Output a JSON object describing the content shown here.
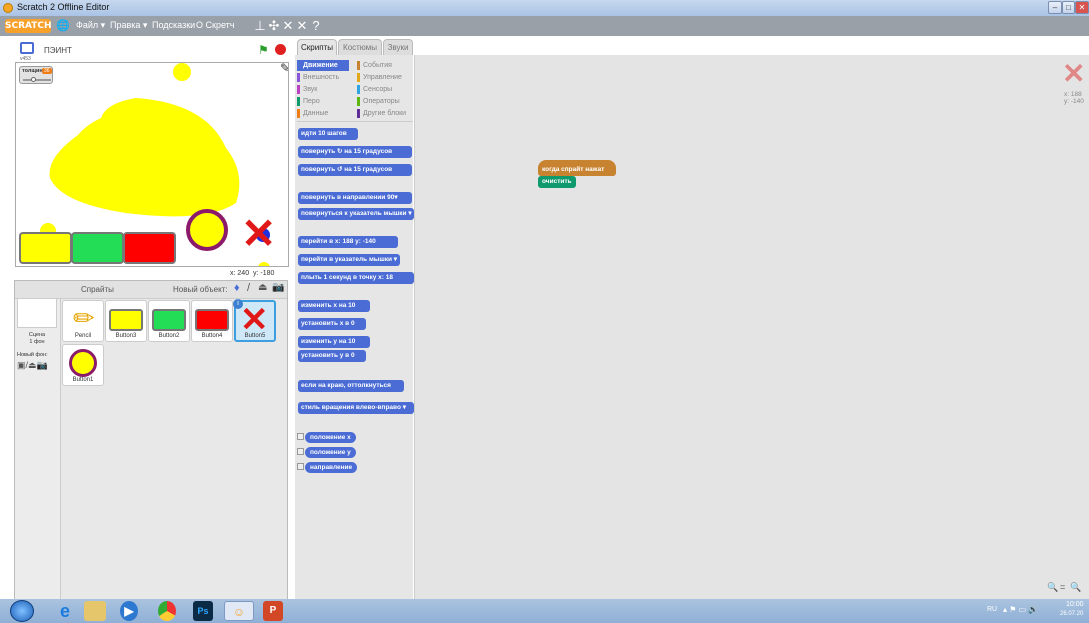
{
  "window": {
    "title": "Scratch 2 Offline Editor"
  },
  "menubar": {
    "logo": "SCRATCH",
    "file": "Файл ▾",
    "edit": "Правка ▾",
    "tips": "Подсказки",
    "about": "О Скретч",
    "tools": [
      "⊥",
      "✣",
      "✕",
      "✕",
      "?"
    ]
  },
  "stage": {
    "project_title": "ПЭИНТ",
    "version": "v453",
    "slider_label": "толщина",
    "slider_value": "36",
    "mouse_x": "240",
    "mouse_y": "-180",
    "x_label": "x:",
    "y_label": "y:"
  },
  "tabs": [
    "Скрипты",
    "Костюмы",
    "Звуки"
  ],
  "categories": [
    {
      "label": "Движение",
      "color": "#4a6cd4"
    },
    {
      "label": "События",
      "color": "#c88330"
    },
    {
      "label": "Внешность",
      "color": "#8a55d7"
    },
    {
      "label": "Управление",
      "color": "#e1a91a"
    },
    {
      "label": "Звук",
      "color": "#bb42c3"
    },
    {
      "label": "Сенсоры",
      "color": "#2ca5e2"
    },
    {
      "label": "Перо",
      "color": "#0e9a6c"
    },
    {
      "label": "Операторы",
      "color": "#5cb712"
    },
    {
      "label": "Данные",
      "color": "#ee7d16"
    },
    {
      "label": "Другие блоки",
      "color": "#632d99"
    }
  ],
  "blocks": [
    "идти 10 шагов",
    "повернуть ↻ на 15 градусов",
    "повернуть ↺ на 15 градусов",
    "повернуть в направлении 90▾",
    "повернуться к указатель мышки ▾",
    "перейти в x: 188 y: -140",
    "перейти в указатель мышки ▾",
    "плыть 1 секунд в точку x: 18",
    "изменить х на 10",
    "установить х в 0",
    "изменить у на 10",
    "установить у в 0",
    "если на краю, оттолкнуться",
    "стиль вращения влево-вправо ▾"
  ],
  "reporters": [
    "положение x",
    "положение y",
    "направление"
  ],
  "sprites": {
    "header": "Спрайты",
    "new_object_label": "Новый объект:",
    "stage_label": "Сцена",
    "stage_sub": "1 фон",
    "new_backdrop_label": "Новый фон:",
    "items": [
      "Pencil",
      "Button3",
      "Button2",
      "Button4",
      "Button5",
      "Button1"
    ],
    "selected": "Button5"
  },
  "scripts": {
    "hat": "когда спрайт нажат",
    "command": "очистить"
  },
  "sprite_info": {
    "x": "x: 188",
    "y": "y: -140"
  },
  "zoom": {
    "out": "🔍",
    "reset": "=",
    "in": "🔍"
  },
  "taskbar": {
    "lang": "RU",
    "time": "10:00",
    "date": "26.07.20"
  }
}
